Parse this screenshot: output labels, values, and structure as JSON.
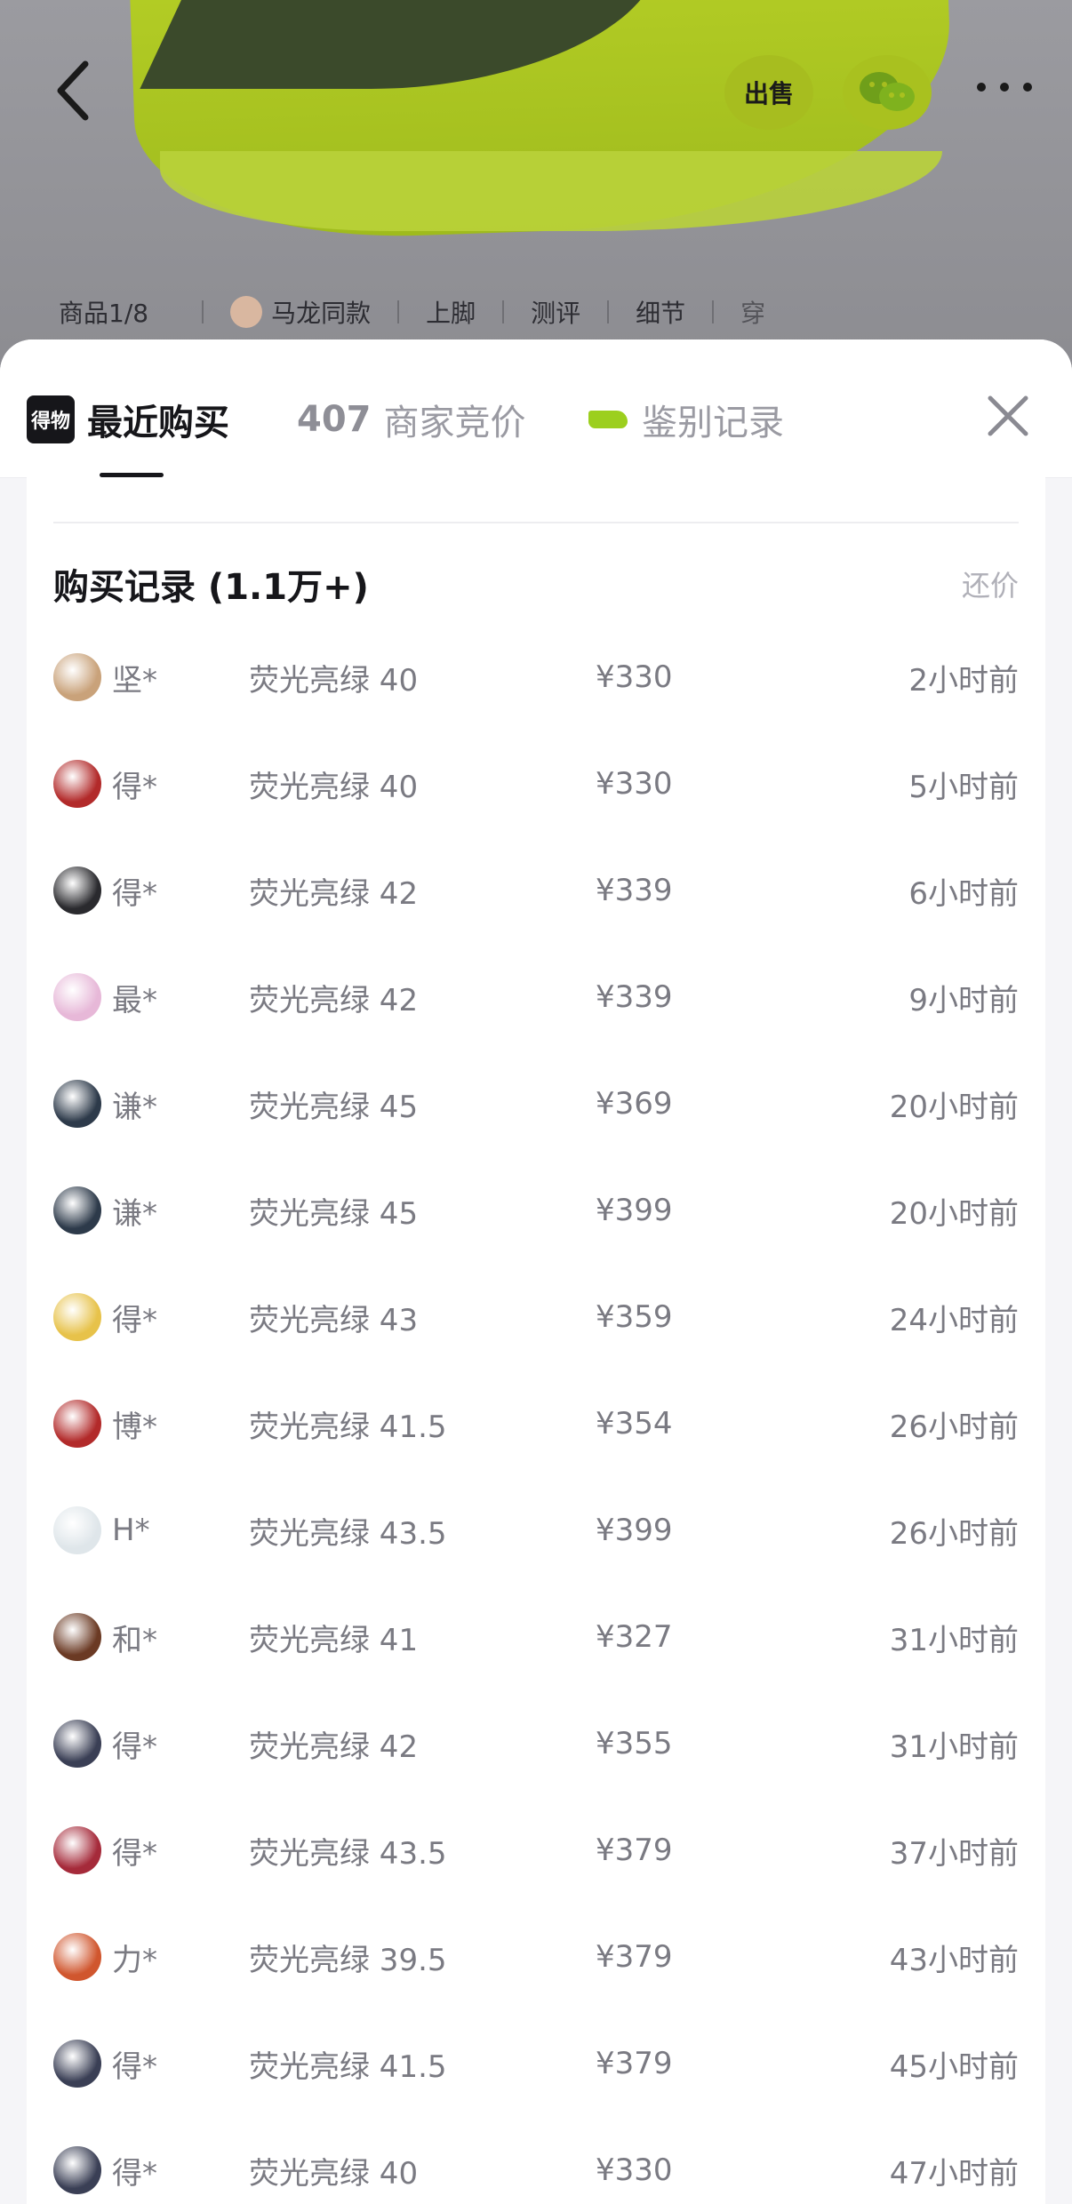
{
  "header": {
    "product_index": "商品1/8",
    "tabs": [
      "马龙同款",
      "上脚",
      "测评",
      "细节",
      "穿"
    ],
    "sell_label": "出售"
  },
  "sheet": {
    "tabs": {
      "recent_logo": "得物",
      "recent": "最近购买",
      "bidding_count": "407",
      "bidding": "商家竞价",
      "auth": "鉴别记录"
    },
    "records_title": "购买记录 (1.1万+)",
    "records_action": "还价",
    "rows": [
      {
        "name": "坚*",
        "spec": "荧光亮绿 40",
        "price": "¥330",
        "time": "2小时前",
        "avatar_color": "#c9a27a"
      },
      {
        "name": "得*",
        "spec": "荧光亮绿 40",
        "price": "¥330",
        "time": "5小时前",
        "avatar_color": "#b22a2a"
      },
      {
        "name": "得*",
        "spec": "荧光亮绿 42",
        "price": "¥339",
        "time": "6小时前",
        "avatar_color": "#2a2a2e"
      },
      {
        "name": "最*",
        "spec": "荧光亮绿 42",
        "price": "¥339",
        "time": "9小时前",
        "avatar_color": "#e7b8d8"
      },
      {
        "name": "谦*",
        "spec": "荧光亮绿 45",
        "price": "¥369",
        "time": "20小时前",
        "avatar_color": "#2d3a4a"
      },
      {
        "name": "谦*",
        "spec": "荧光亮绿 45",
        "price": "¥399",
        "time": "20小时前",
        "avatar_color": "#2d3a4a"
      },
      {
        "name": "得*",
        "spec": "荧光亮绿 43",
        "price": "¥359",
        "time": "24小时前",
        "avatar_color": "#e7c24a"
      },
      {
        "name": "博*",
        "spec": "荧光亮绿 41.5",
        "price": "¥354",
        "time": "26小时前",
        "avatar_color": "#b22a2a"
      },
      {
        "name": "H*",
        "spec": "荧光亮绿 43.5",
        "price": "¥399",
        "time": "26小时前",
        "avatar_color": "#dfe6ea"
      },
      {
        "name": "和*",
        "spec": "荧光亮绿 41",
        "price": "¥327",
        "time": "31小时前",
        "avatar_color": "#6b3a24"
      },
      {
        "name": "得*",
        "spec": "荧光亮绿 42",
        "price": "¥355",
        "time": "31小时前",
        "avatar_color": "#3a3f55"
      },
      {
        "name": "得*",
        "spec": "荧光亮绿 43.5",
        "price": "¥379",
        "time": "37小时前",
        "avatar_color": "#a52a3a"
      },
      {
        "name": "力*",
        "spec": "荧光亮绿 39.5",
        "price": "¥379",
        "time": "43小时前",
        "avatar_color": "#d0562e"
      },
      {
        "name": "得*",
        "spec": "荧光亮绿 41.5",
        "price": "¥379",
        "time": "45小时前",
        "avatar_color": "#3a3f55"
      },
      {
        "name": "得*",
        "spec": "荧光亮绿 40",
        "price": "¥330",
        "time": "47小时前",
        "avatar_color": "#3a3f55"
      }
    ]
  }
}
